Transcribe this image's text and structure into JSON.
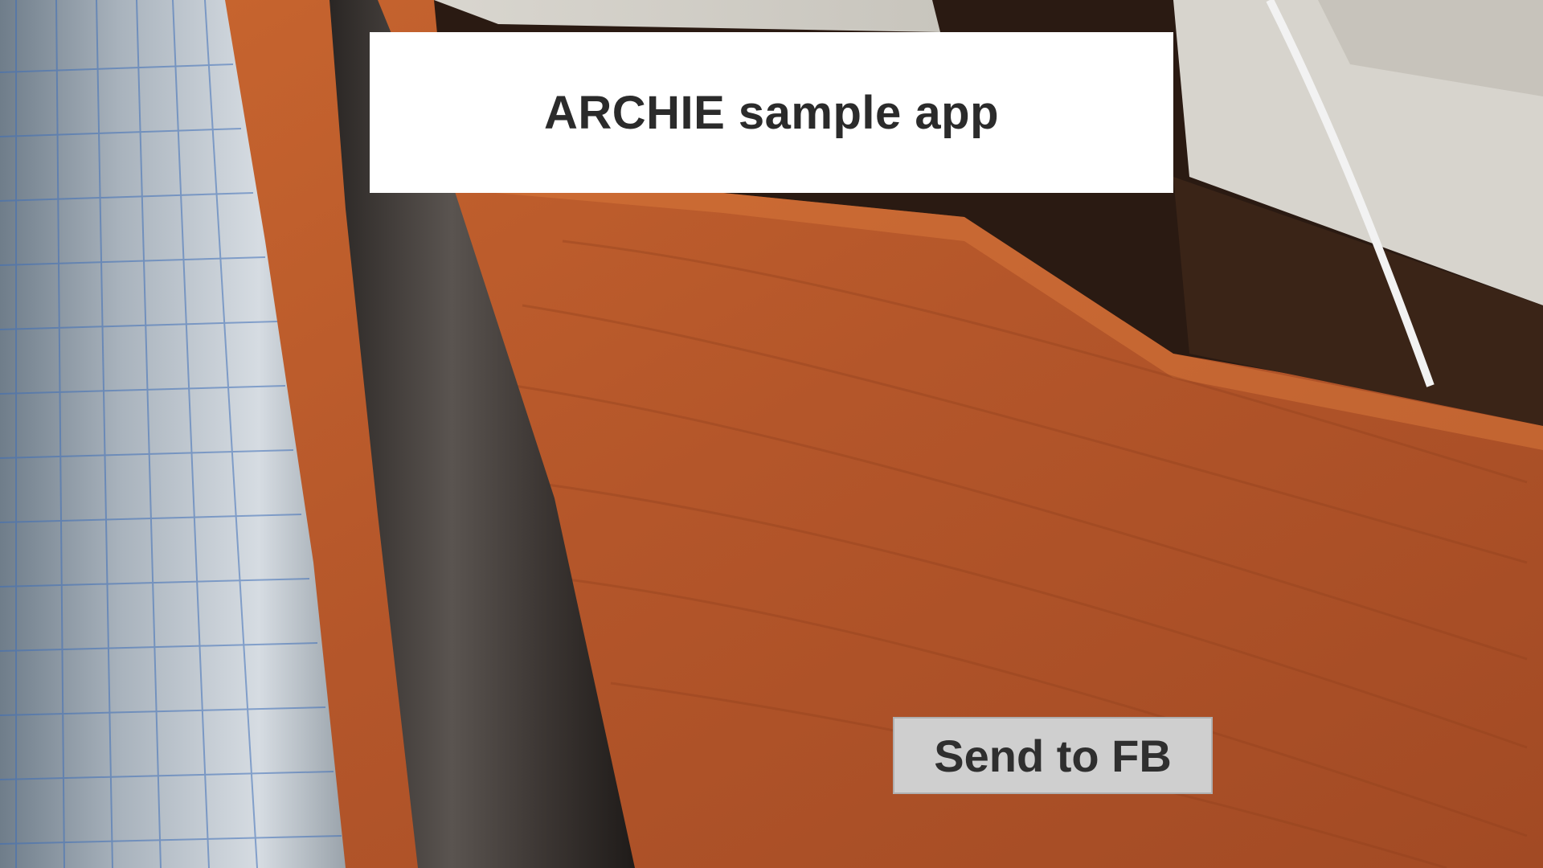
{
  "app": {
    "title": "ARCHIE sample app"
  },
  "camera_view": {
    "description_icon": "camera-feed"
  },
  "actions": {
    "send_label": "Send to FB"
  },
  "colors": {
    "banner_bg": "#ffffff",
    "title_text": "#2b2b2b",
    "button_bg": "#cfcfcf",
    "button_text": "#2f2f2f",
    "table_wood": "#b85a2c"
  }
}
